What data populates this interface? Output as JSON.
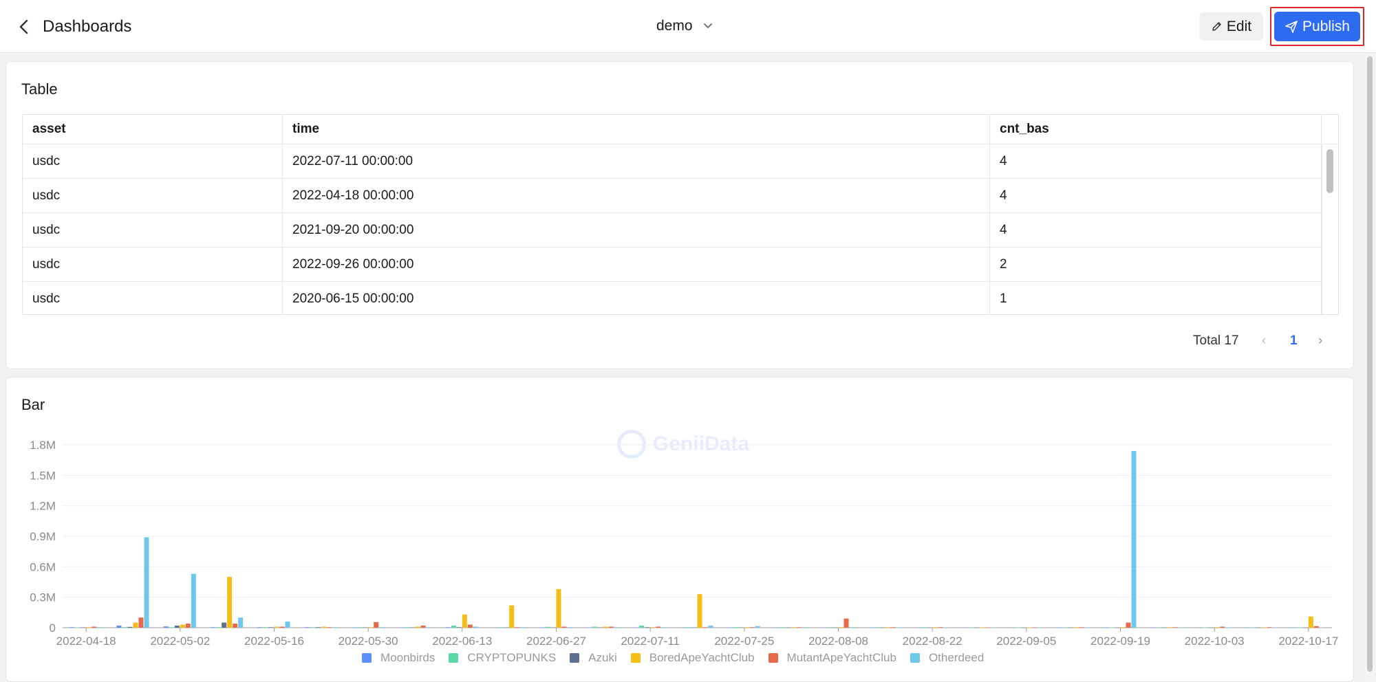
{
  "header": {
    "back_label": "",
    "title": "Dashboards",
    "dashboard_name": "demo",
    "edit_label": "Edit",
    "publish_label": "Publish"
  },
  "table_card": {
    "title": "Table",
    "columns": [
      "asset",
      "time",
      "cnt_bas"
    ],
    "rows": [
      [
        "usdc",
        "2022-07-11 00:00:00",
        "4"
      ],
      [
        "usdc",
        "2022-04-18 00:00:00",
        "4"
      ],
      [
        "usdc",
        "2021-09-20 00:00:00",
        "4"
      ],
      [
        "usdc",
        "2022-09-26 00:00:00",
        "2"
      ],
      [
        "usdc",
        "2020-06-15 00:00:00",
        "1"
      ]
    ],
    "pagination": {
      "total_label": "Total 17",
      "current_page": "1",
      "prev_icon": "chevron-left-icon",
      "next_icon": "chevron-right-icon"
    }
  },
  "bar_card": {
    "title": "Bar",
    "watermark": "GeniiData"
  },
  "colors": {
    "accent": "#2d6bf0",
    "moonbirds": "#5b8ff9",
    "cryptopunks": "#5ad8a6",
    "azuki": "#5d7092",
    "boredape": "#f6bd16",
    "mutantape": "#e8684a",
    "otherdeed": "#6dc8ec"
  },
  "chart_data": {
    "type": "bar",
    "title": "Bar",
    "xlabel": "",
    "ylabel": "",
    "ylim": [
      0,
      1800000
    ],
    "yticks": [
      0,
      300000,
      600000,
      900000,
      1200000,
      1500000,
      1800000
    ],
    "ytick_labels": [
      "0",
      "0.3M",
      "0.6M",
      "0.9M",
      "1.2M",
      "1.5M",
      "1.8M"
    ],
    "xtick_labels": [
      "2022-04-18",
      "2022-05-02",
      "2022-05-16",
      "2022-05-30",
      "2022-06-13",
      "2022-06-27",
      "2022-07-11",
      "2022-07-25",
      "2022-08-08",
      "2022-08-22",
      "2022-09-05",
      "2022-09-19",
      "2022-10-03",
      "2022-10-17"
    ],
    "legend_position": "bottom",
    "categories": [
      "2022-04-18",
      "2022-04-25",
      "2022-05-02",
      "2022-05-09",
      "2022-05-16",
      "2022-05-23",
      "2022-05-30",
      "2022-06-06",
      "2022-06-13",
      "2022-06-20",
      "2022-06-27",
      "2022-07-04",
      "2022-07-11",
      "2022-07-18",
      "2022-07-25",
      "2022-08-01",
      "2022-08-08",
      "2022-08-15",
      "2022-08-22",
      "2022-08-29",
      "2022-09-05",
      "2022-09-12",
      "2022-09-19",
      "2022-09-26",
      "2022-10-03",
      "2022-10-10",
      "2022-10-17"
    ],
    "series": [
      {
        "name": "Moonbirds",
        "values": [
          5000,
          20000,
          12000,
          5000,
          5000,
          5000,
          3000,
          3000,
          5000,
          3000,
          3000,
          3000,
          3000,
          3000,
          3000,
          2000,
          2000,
          2000,
          2000,
          1000,
          1000,
          1000,
          1000,
          1000,
          1000,
          1000,
          1000
        ]
      },
      {
        "name": "CRYPTOPUNKS",
        "values": [
          3000,
          5000,
          5000,
          5000,
          5000,
          5000,
          5000,
          5000,
          20000,
          5000,
          8000,
          10000,
          20000,
          5000,
          5000,
          5000,
          5000,
          5000,
          5000,
          3000,
          3000,
          3000,
          3000,
          3000,
          3000,
          3000,
          3000
        ]
      },
      {
        "name": "Azuki",
        "values": [
          3000,
          8000,
          20000,
          50000,
          5000,
          5000,
          3000,
          3000,
          5000,
          3000,
          3000,
          3000,
          5000,
          3000,
          3000,
          2000,
          2000,
          2000,
          2000,
          1000,
          1000,
          1000,
          1000,
          1000,
          1000,
          1000,
          1000
        ]
      },
      {
        "name": "BoredApeYachtClub",
        "values": [
          5000,
          50000,
          30000,
          500000,
          10000,
          10000,
          5000,
          10000,
          130000,
          220000,
          380000,
          10000,
          5000,
          330000,
          5000,
          5000,
          5000,
          5000,
          5000,
          3000,
          3000,
          5000,
          5000,
          5000,
          5000,
          3000,
          110000
        ]
      },
      {
        "name": "MutantApeYachtClub",
        "values": [
          10000,
          100000,
          40000,
          40000,
          10000,
          5000,
          55000,
          20000,
          30000,
          5000,
          10000,
          10000,
          10000,
          5000,
          5000,
          5000,
          90000,
          5000,
          5000,
          3000,
          3000,
          5000,
          50000,
          5000,
          10000,
          5000,
          15000
        ]
      },
      {
        "name": "Otherdeed",
        "values": [
          5000,
          890000,
          530000,
          100000,
          60000,
          5000,
          5000,
          5000,
          10000,
          5000,
          5000,
          5000,
          5000,
          20000,
          15000,
          5000,
          5000,
          3000,
          3000,
          3000,
          3000,
          3000,
          1740000,
          3000,
          3000,
          3000,
          3000
        ]
      }
    ]
  }
}
